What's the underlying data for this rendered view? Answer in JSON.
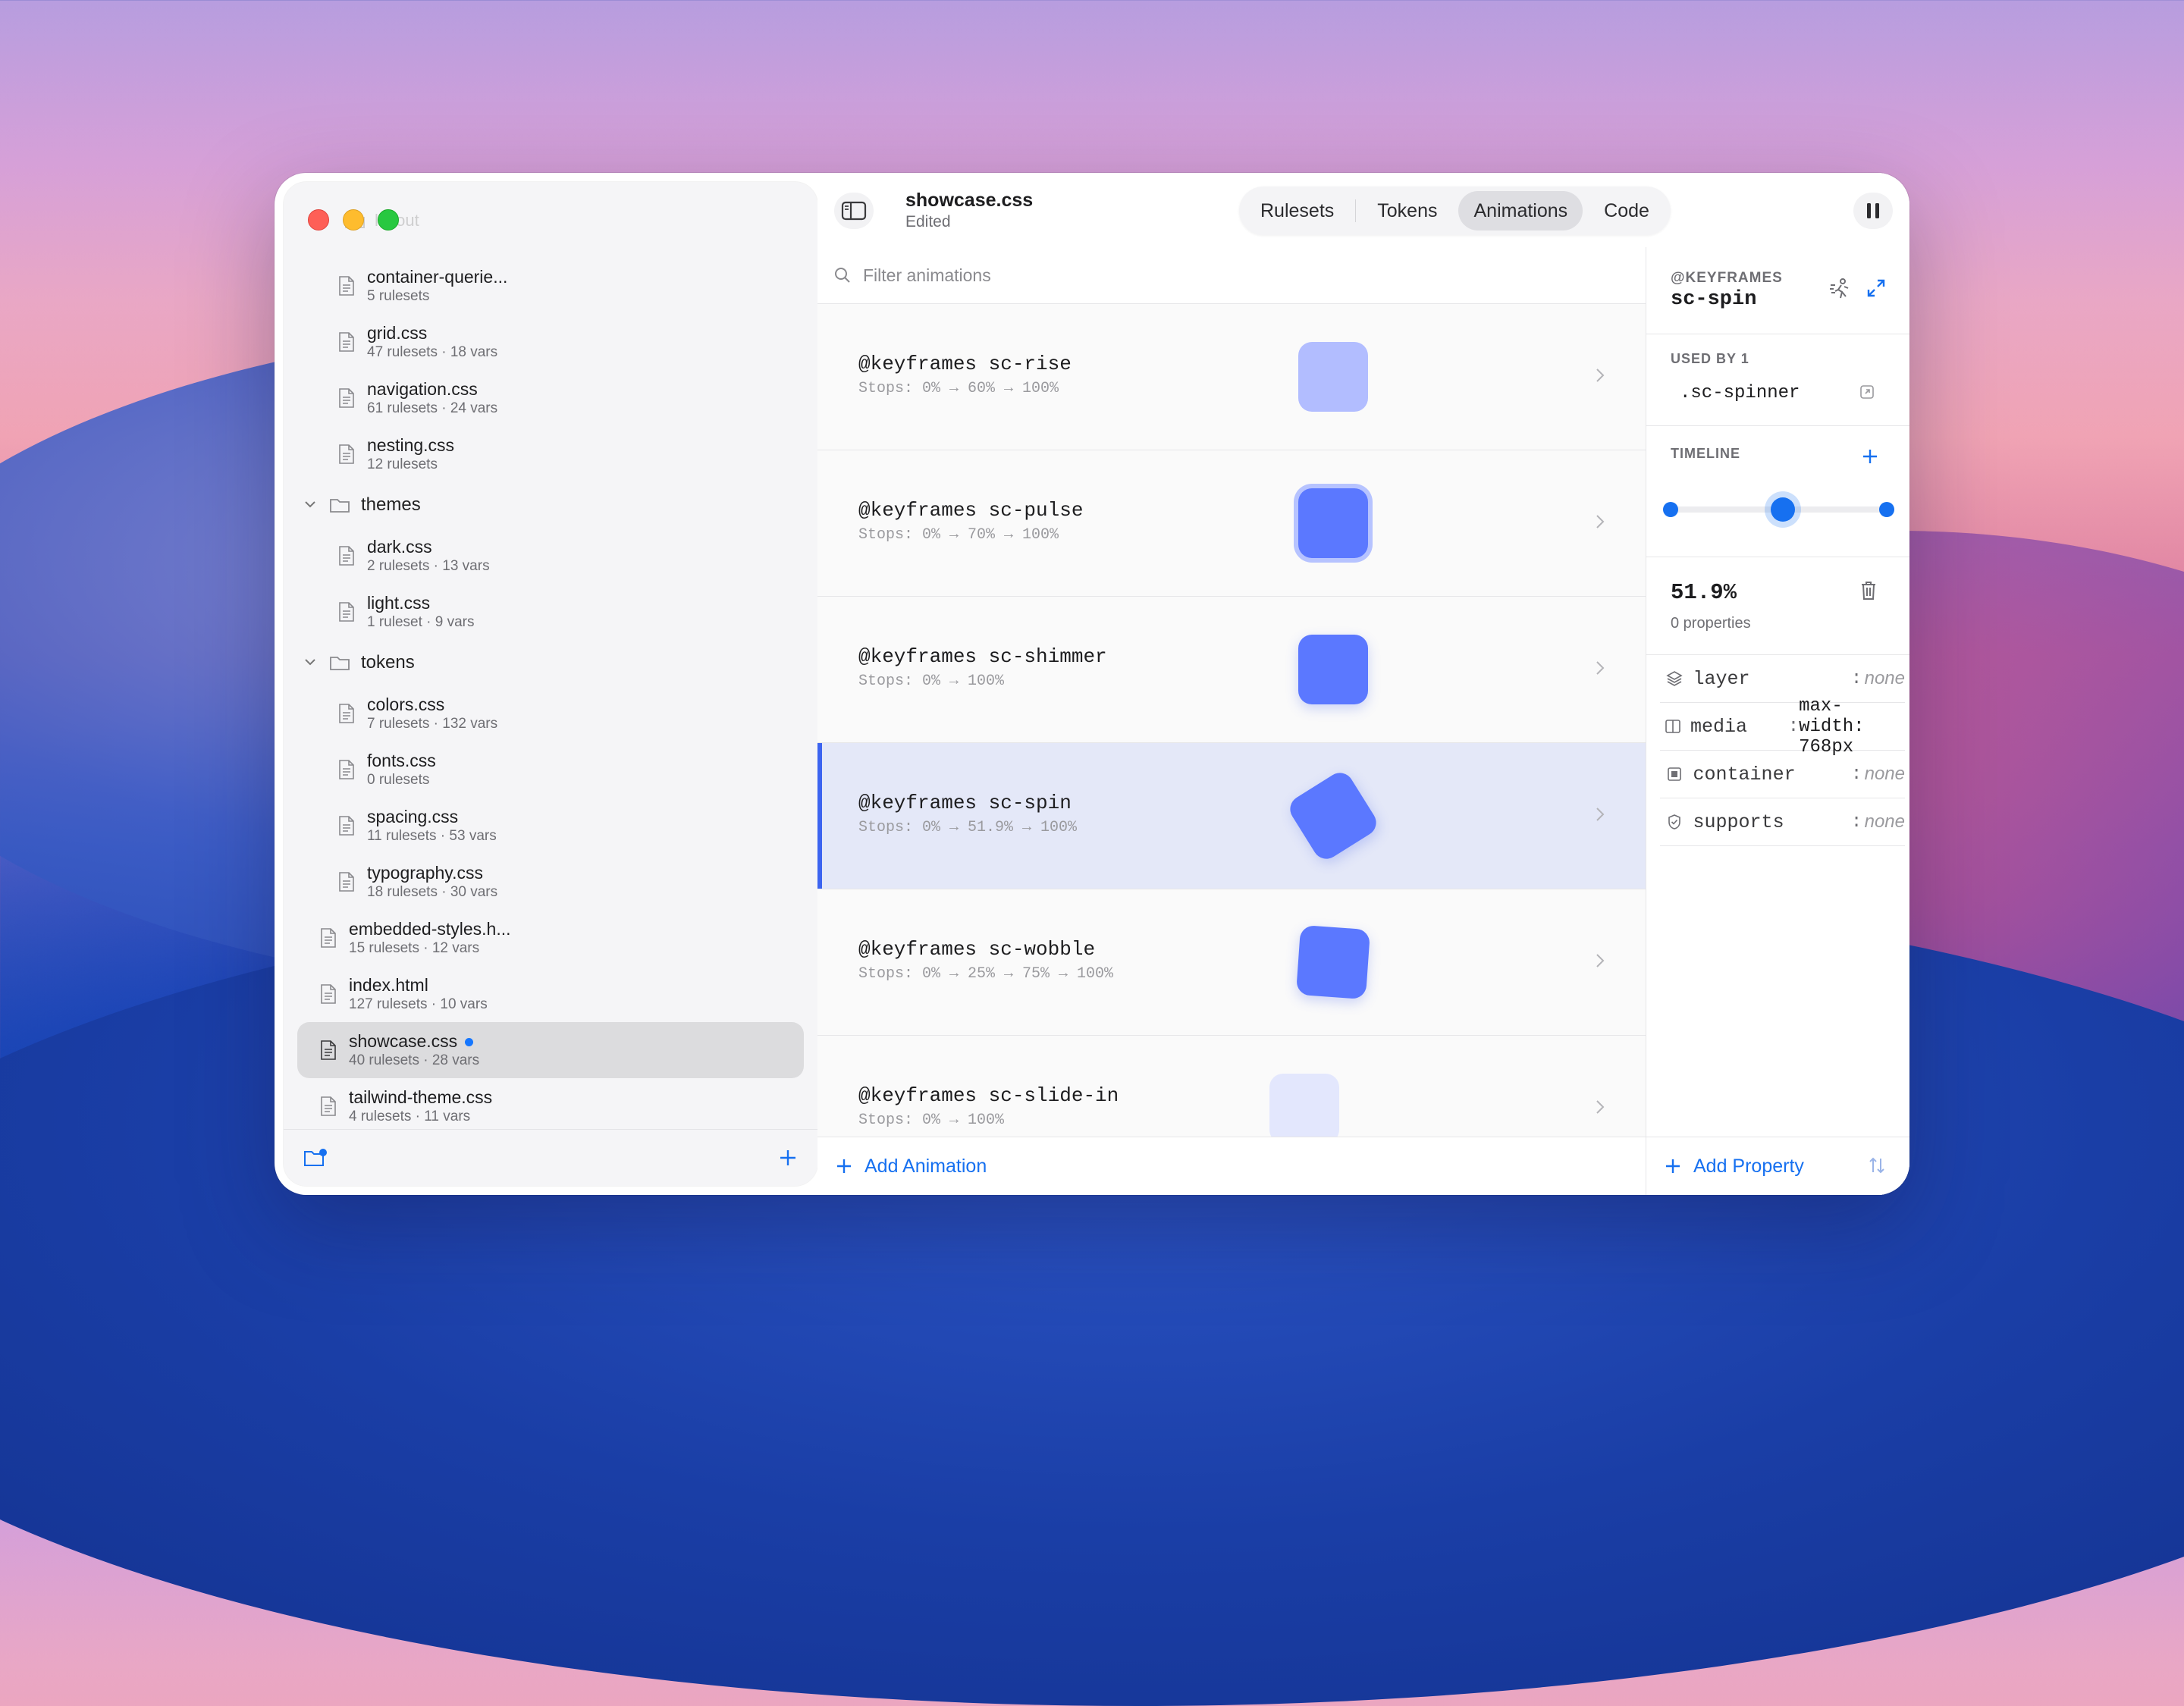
{
  "sidebar": {
    "ghost_folder": "layout",
    "files_layout": [
      {
        "name": "container-querie...",
        "meta": "5 rulesets"
      },
      {
        "name": "grid.css",
        "meta": "47 rulesets · 18 vars"
      },
      {
        "name": "navigation.css",
        "meta": "61 rulesets · 24 vars"
      },
      {
        "name": "nesting.css",
        "meta": "12 rulesets"
      }
    ],
    "folder_themes": "themes",
    "files_themes": [
      {
        "name": "dark.css",
        "meta": "2 rulesets · 13 vars"
      },
      {
        "name": "light.css",
        "meta": "1 ruleset · 9 vars"
      }
    ],
    "folder_tokens": "tokens",
    "files_tokens": [
      {
        "name": "colors.css",
        "meta": "7 rulesets · 132 vars"
      },
      {
        "name": "fonts.css",
        "meta": "0 rulesets"
      },
      {
        "name": "spacing.css",
        "meta": "11 rulesets · 53 vars"
      },
      {
        "name": "typography.css",
        "meta": "18 rulesets · 30 vars"
      }
    ],
    "files_root": [
      {
        "name": "embedded-styles.h...",
        "meta": "15 rulesets · 12 vars"
      },
      {
        "name": "index.html",
        "meta": "127 rulesets · 10 vars"
      },
      {
        "name": "showcase.css",
        "meta": "40 rulesets · 28 vars"
      },
      {
        "name": "tailwind-theme.css",
        "meta": "4 rulesets · 11 vars"
      }
    ]
  },
  "toolbar": {
    "doc_name": "showcase.css",
    "doc_status": "Edited",
    "tabs": [
      "Rulesets",
      "Tokens",
      "Animations",
      "Code"
    ],
    "active_tab": "Animations"
  },
  "animations": {
    "filter_placeholder": "Filter animations",
    "items": [
      {
        "name": "@keyframes sc-rise",
        "stops": "Stops: 0% → 60% → 100%"
      },
      {
        "name": "@keyframes sc-pulse",
        "stops": "Stops: 0% → 70% → 100%"
      },
      {
        "name": "@keyframes sc-shimmer",
        "stops": "Stops: 0% → 100%"
      },
      {
        "name": "@keyframes sc-spin",
        "stops": "Stops: 0% → 51.9% → 100%"
      },
      {
        "name": "@keyframes sc-wobble",
        "stops": "Stops: 0% → 25% → 75% → 100%"
      },
      {
        "name": "@keyframes sc-slide-in",
        "stops": "Stops: 0% → 100%"
      }
    ],
    "selected_index": 3,
    "add_label": "Add Animation"
  },
  "inspector": {
    "kicker": "@KEYFRAMES",
    "title": "sc-spin",
    "used_by_label": "USED BY 1",
    "used_by": [
      ".sc-spinner"
    ],
    "timeline_label": "TIMELINE",
    "timeline_stops": [
      0,
      51.9,
      100
    ],
    "selected_stop": 51.9,
    "keyframe_pct": "51.9%",
    "keyframe_props": "0 properties",
    "conditions": [
      {
        "key": "layer",
        "value": "none",
        "icon": "layers-icon"
      },
      {
        "key": "media",
        "value": "max-width: 768px",
        "icon": "media-icon"
      },
      {
        "key": "container",
        "value": "none",
        "icon": "container-icon"
      },
      {
        "key": "supports",
        "value": "none",
        "icon": "supports-icon"
      }
    ],
    "add_property_label": "Add Property"
  },
  "colors": {
    "accent": "#1670f0",
    "preview": "#5b78ff",
    "selected_row": "#e4e8f8"
  }
}
